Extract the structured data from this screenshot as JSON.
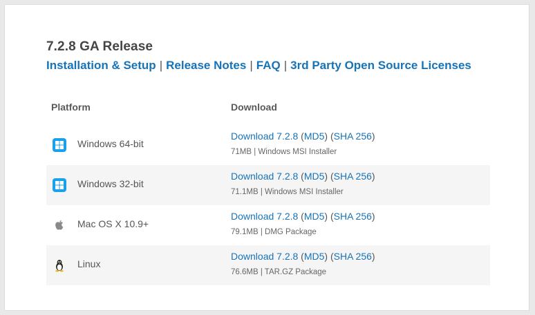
{
  "release": {
    "title": "7.2.8 GA Release",
    "links": [
      {
        "label": "Installation & Setup"
      },
      {
        "label": "Release Notes"
      },
      {
        "label": "FAQ"
      },
      {
        "label": "3rd Party Open Source Licenses"
      }
    ],
    "separator": "|"
  },
  "table": {
    "headers": {
      "platform": "Platform",
      "download": "Download"
    },
    "rows": [
      {
        "icon": "windows-icon",
        "platform": "Windows 64-bit",
        "download_label": "Download 7.2.8",
        "md5_label": "MD5",
        "sha_label": "SHA 256",
        "meta": "71MB | Windows MSI Installer"
      },
      {
        "icon": "windows-icon",
        "platform": "Windows 32-bit",
        "download_label": "Download 7.2.8",
        "md5_label": "MD5",
        "sha_label": "SHA 256",
        "meta": "71.1MB | Windows MSI Installer"
      },
      {
        "icon": "apple-icon",
        "platform": "Mac OS X 10.9+",
        "download_label": "Download 7.2.8",
        "md5_label": "MD5",
        "sha_label": "SHA 256",
        "meta": "79.1MB | DMG Package"
      },
      {
        "icon": "linux-icon",
        "platform": "Linux",
        "download_label": "Download 7.2.8",
        "md5_label": "MD5",
        "sha_label": "SHA 256",
        "meta": "76.6MB | TAR.GZ Package"
      }
    ]
  },
  "colors": {
    "link": "#1773b8",
    "windows": "#1aa1ec",
    "row_shade": "#f5f5f5"
  }
}
